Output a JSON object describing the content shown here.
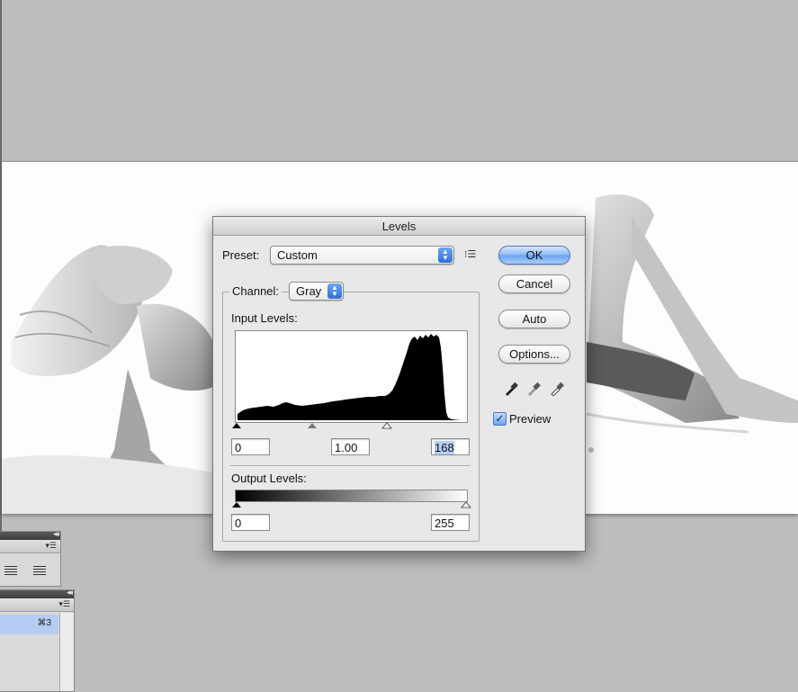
{
  "dialog": {
    "title": "Levels",
    "preset_label": "Preset:",
    "preset_value": "Custom",
    "channel_label": "Channel:",
    "channel_value": "Gray",
    "input_levels_label": "Input Levels:",
    "input_black": "0",
    "input_gamma": "1.00",
    "input_white": "168",
    "output_levels_label": "Output Levels:",
    "output_black": "0",
    "output_white": "255",
    "buttons": {
      "ok": "OK",
      "cancel": "Cancel",
      "auto": "Auto",
      "options": "Options..."
    },
    "preview_label": "Preview",
    "preview_checked": true,
    "colors": {
      "accent": "#6aa3ee",
      "selection": "#b4d0f7"
    }
  },
  "panels": {
    "swatch_shortcut": "⌘3"
  },
  "icons": [
    "preset-options-icon",
    "black-eyedropper-icon",
    "gray-eyedropper-icon",
    "white-eyedropper-icon",
    "popup-arrows-icon",
    "checkmark-icon",
    "panel-menu-icon",
    "panel-collapse-icon",
    "align-justify-icon"
  ]
}
